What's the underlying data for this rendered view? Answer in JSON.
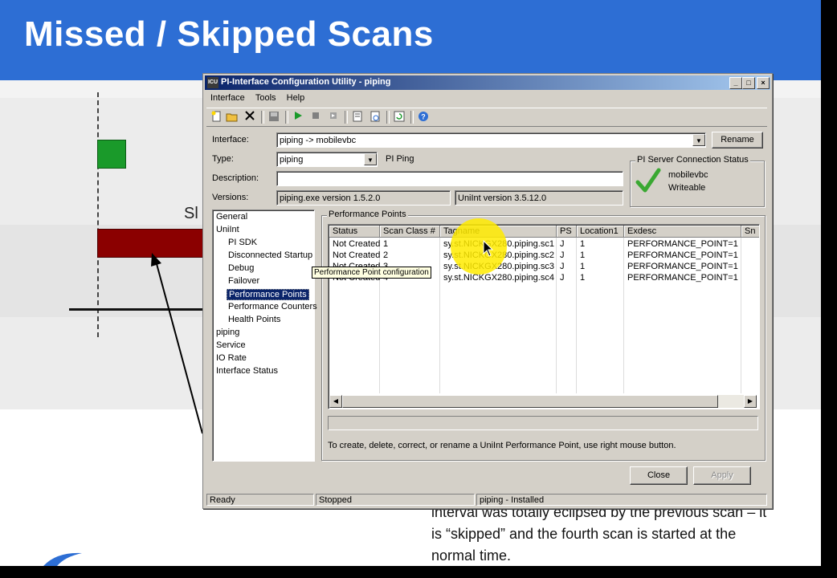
{
  "slide": {
    "title": "Missed / Skipped Scans",
    "partial_label": "Sl",
    "body_text": "interval was totally eclipsed by the previous scan – it is “skipped” and the fourth scan is started at the normal time."
  },
  "window": {
    "icon_text": "ICU",
    "title": "PI-Interface Configuration Utility - piping",
    "controls": {
      "minimize": "_",
      "maximize": "□",
      "close": "×"
    }
  },
  "menu": [
    "Interface",
    "Tools",
    "Help"
  ],
  "form": {
    "interface_label": "Interface:",
    "interface_value": "piping -> mobilevbc",
    "rename_label": "Rename",
    "type_label": "Type:",
    "type_value": "piping",
    "type_desc": "PI Ping",
    "description_label": "Description:",
    "description_value": "",
    "versions_label": "Versions:",
    "version_exe": "piping.exe version 1.5.2.0",
    "version_uniint": "UniInt version 3.5.12.0"
  },
  "server_status": {
    "title": "PI Server Connection Status",
    "server": "mobilevbc",
    "state": "Writeable"
  },
  "tree": {
    "items": [
      {
        "label": "General",
        "indent": 0
      },
      {
        "label": "UniInt",
        "indent": 0
      },
      {
        "label": "PI SDK",
        "indent": 1
      },
      {
        "label": "Disconnected Startup",
        "indent": 1
      },
      {
        "label": "Debug",
        "indent": 1
      },
      {
        "label": "Failover",
        "indent": 1
      },
      {
        "label": "Performance Points",
        "indent": 1,
        "selected": true
      },
      {
        "label": "Performance Counters",
        "indent": 1
      },
      {
        "label": "Health Points",
        "indent": 1
      },
      {
        "label": "piping",
        "indent": 0
      },
      {
        "label": "Service",
        "indent": 0
      },
      {
        "label": "IO Rate",
        "indent": 0
      },
      {
        "label": "Interface Status",
        "indent": 0
      }
    ]
  },
  "perf": {
    "group_title": "Performance Points",
    "columns": [
      "Status",
      "Scan Class #",
      "Tagname",
      "PS",
      "Location1",
      "Exdesc",
      "Sn"
    ],
    "rows": [
      [
        "Not Created",
        "1",
        "sy.st.NICKGX280.piping.sc1",
        "J",
        "1",
        "PERFORMANCE_POINT=1"
      ],
      [
        "Not Created",
        "2",
        "sy.st.NICKGX280.piping.sc2",
        "J",
        "1",
        "PERFORMANCE_POINT=1"
      ],
      [
        "Not Created",
        "3",
        "sy.st.NICKGX280.piping.sc3",
        "J",
        "1",
        "PERFORMANCE_POINT=1"
      ],
      [
        "Not Created",
        "4",
        "sy.st.NICKGX280.piping.sc4",
        "J",
        "1",
        "PERFORMANCE_POINT=1"
      ]
    ],
    "tooltip": "Performance Point configuration",
    "hint": "To create, delete, correct, or rename a UniInt Performance Point, use right mouse button."
  },
  "buttons": {
    "close": "Close",
    "apply": "Apply"
  },
  "status": {
    "ready": "Ready",
    "state": "Stopped",
    "service": "piping - Installed"
  },
  "colors": {
    "title_bar": "#2d6ed4",
    "window_caption": "#0a246a",
    "check": "#3aa832",
    "highlight": "#ffeb00"
  }
}
